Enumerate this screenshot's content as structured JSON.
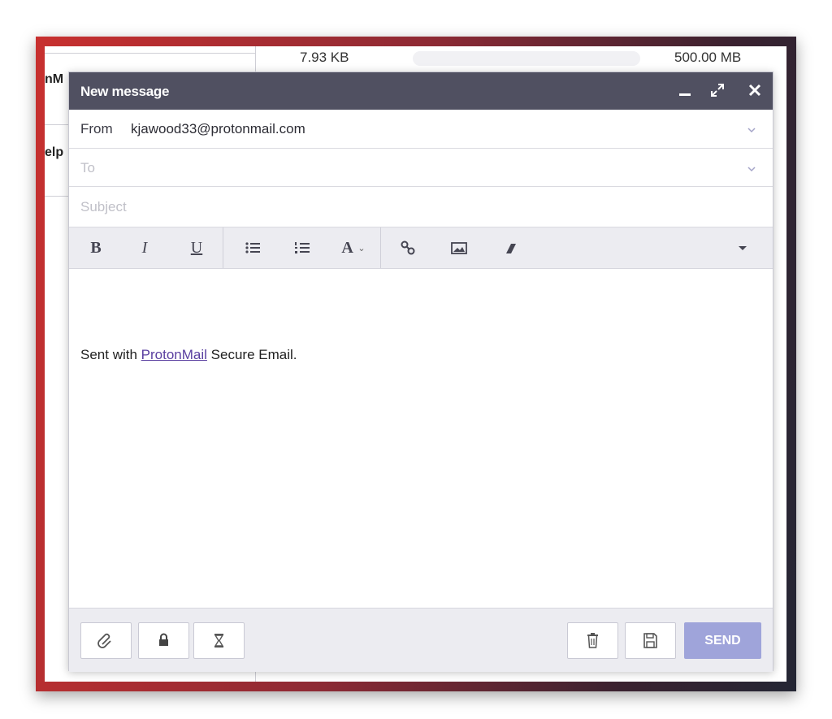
{
  "background": {
    "left_text_1": "nM",
    "left_text_2": "elp",
    "storage_used": "7.93 KB",
    "storage_total": "500.00 MB"
  },
  "composer": {
    "title": "New message",
    "window_controls": [
      "minimize-icon",
      "expand-icon",
      "close-icon"
    ],
    "from_label": "From",
    "from_value": "kjawood33@protonmail.com",
    "to_placeholder": "To",
    "subject_placeholder": "Subject",
    "toolbar": {
      "bold": "B",
      "italic": "I",
      "underline": "U",
      "font_size": "A"
    },
    "signature_prefix": "Sent with",
    "signature_link": "ProtonMail",
    "signature_suffix": "Secure Email.",
    "send_label": "SEND"
  },
  "colors": {
    "titlebar": "#505061",
    "send_button": "#9fa4da",
    "link": "#5a3fa0"
  }
}
